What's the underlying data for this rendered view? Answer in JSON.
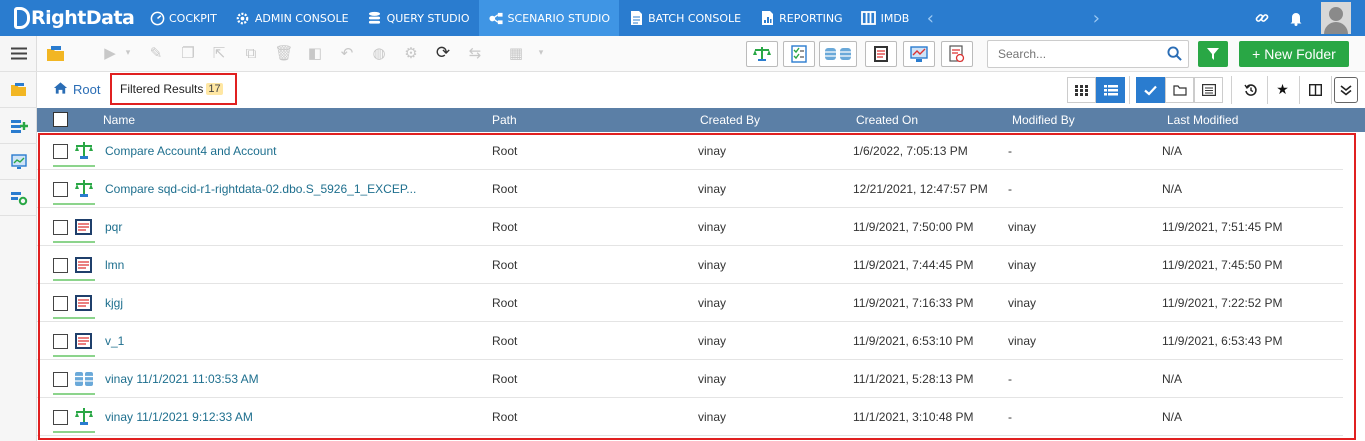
{
  "nav": {
    "brand": "RightData",
    "items": [
      {
        "label": "COCKPIT",
        "icon": "gauge-icon"
      },
      {
        "label": "ADMIN CONSOLE",
        "icon": "gear-icon"
      },
      {
        "label": "QUERY STUDIO",
        "icon": "database-icon"
      },
      {
        "label": "SCENARIO STUDIO",
        "icon": "workflow-icon",
        "active": true
      },
      {
        "label": "BATCH CONSOLE",
        "icon": "document-icon"
      },
      {
        "label": "REPORTING",
        "icon": "report-icon"
      },
      {
        "label": "IMDB",
        "icon": "columns-icon"
      }
    ],
    "right_icons": [
      "link-icon",
      "bell-icon",
      "user-avatar"
    ]
  },
  "toolbar": {
    "search_placeholder": "Search...",
    "new_folder_label": "+ New Folder",
    "colors": {
      "accent": "#2a7ccf",
      "green": "#29a745",
      "header": "#5b7fa6",
      "highlight": "#e02020"
    }
  },
  "breadcrumb": {
    "root_label": "Root",
    "filtered_label": "Filtered Results",
    "filtered_count": "17"
  },
  "table": {
    "columns": [
      "Name",
      "Path",
      "Created By",
      "Created On",
      "Modified By",
      "Last Modified"
    ],
    "rows": [
      {
        "icon": "compare-icon",
        "name": "Compare Account4 and Account",
        "path": "Root",
        "created_by": "vinay",
        "created_on": "1/6/2022, 7:05:13 PM",
        "modified_by": "-",
        "last_modified": "N/A"
      },
      {
        "icon": "compare-icon",
        "name": "Compare sqd-cid-r1-rightdata-02.dbo.S_5926_1_EXCEP...",
        "path": "Root",
        "created_by": "vinay",
        "created_on": "12/21/2021, 12:47:57 PM",
        "modified_by": "-",
        "last_modified": "N/A"
      },
      {
        "icon": "scenario-icon",
        "name": "pqr",
        "path": "Root",
        "created_by": "vinay",
        "created_on": "11/9/2021, 7:50:00 PM",
        "modified_by": "vinay",
        "last_modified": "11/9/2021, 7:51:45 PM"
      },
      {
        "icon": "scenario-icon",
        "name": "lmn",
        "path": "Root",
        "created_by": "vinay",
        "created_on": "11/9/2021, 7:44:45 PM",
        "modified_by": "vinay",
        "last_modified": "11/9/2021, 7:45:50 PM"
      },
      {
        "icon": "scenario-icon",
        "name": "kjgj",
        "path": "Root",
        "created_by": "vinay",
        "created_on": "11/9/2021, 7:16:33 PM",
        "modified_by": "vinay",
        "last_modified": "11/9/2021, 7:22:52 PM"
      },
      {
        "icon": "scenario-icon",
        "name": "v_1",
        "path": "Root",
        "created_by": "vinay",
        "created_on": "11/9/2021, 6:53:10 PM",
        "modified_by": "vinay",
        "last_modified": "11/9/2021, 6:53:43 PM"
      },
      {
        "icon": "database-icon",
        "name": "vinay 11/1/2021 11:03:53 AM",
        "path": "Root",
        "created_by": "vinay",
        "created_on": "11/1/2021, 5:28:13 PM",
        "modified_by": "-",
        "last_modified": "N/A"
      },
      {
        "icon": "compare-icon",
        "name": "vinay 11/1/2021 9:12:33 AM",
        "path": "Root",
        "created_by": "vinay",
        "created_on": "11/1/2021, 3:10:48 PM",
        "modified_by": "-",
        "last_modified": "N/A"
      }
    ]
  }
}
